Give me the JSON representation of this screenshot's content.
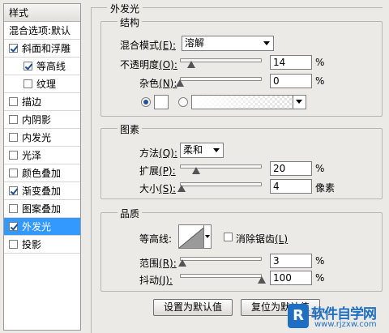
{
  "sidebar": {
    "header": "样式",
    "blend_options": "混合选项:默认",
    "items": [
      {
        "label": "斜面和浮雕",
        "checked": true
      },
      {
        "label": "等高线",
        "checked": true
      },
      {
        "label": "纹理",
        "checked": false
      },
      {
        "label": "描边",
        "checked": false
      },
      {
        "label": "内阴影",
        "checked": false
      },
      {
        "label": "内发光",
        "checked": false
      },
      {
        "label": "光泽",
        "checked": false
      },
      {
        "label": "颜色叠加",
        "checked": false
      },
      {
        "label": "渐变叠加",
        "checked": true
      },
      {
        "label": "图案叠加",
        "checked": false
      },
      {
        "label": "外发光",
        "checked": true
      },
      {
        "label": "投影",
        "checked": false
      }
    ]
  },
  "panel_title": "外发光",
  "structure": {
    "legend": "结构",
    "blend_mode_label": "混合模式",
    "blend_mode_key": "(E):",
    "blend_mode_value": "溶解",
    "opacity_label": "不透明度",
    "opacity_key": "(O):",
    "opacity_value": "14",
    "opacity_level": 0.14,
    "noise_label": "杂色",
    "noise_key": "(N):",
    "noise_value": "0",
    "noise_level": 0.0,
    "unit": "%",
    "color_swatch": "#ffffff"
  },
  "elements": {
    "legend": "图素",
    "method_label": "方法",
    "method_key": "(Q):",
    "method_value": "柔和",
    "spread_label": "扩展",
    "spread_key": "(P):",
    "spread_value": "20",
    "spread_level": 0.2,
    "size_label": "大小",
    "size_key": "(S):",
    "size_value": "4",
    "size_level": 0.02,
    "size_unit": "像素",
    "unit": "%"
  },
  "quality": {
    "legend": "品质",
    "contour_label": "等高线:",
    "antialias_label": "消除锯齿",
    "antialias_key": "(L)",
    "antialias_checked": false,
    "range_label": "范围",
    "range_key": "(R):",
    "range_value": "3",
    "range_level": 0.03,
    "jitter_label": "抖动",
    "jitter_key": "(J):",
    "jitter_value": "100",
    "jitter_level": 1.0,
    "unit": "%"
  },
  "buttons": {
    "make_default": "设置为默认值",
    "reset_default": "复位为默认值"
  },
  "watermark": {
    "icon_letter": "R",
    "title": "软件自学网",
    "url": "www.rjzxw.com"
  },
  "colors": {
    "selected_bg": "#3399ff",
    "panel_bg": "#eceae6",
    "watermark_blue": "#1e6fc4"
  }
}
